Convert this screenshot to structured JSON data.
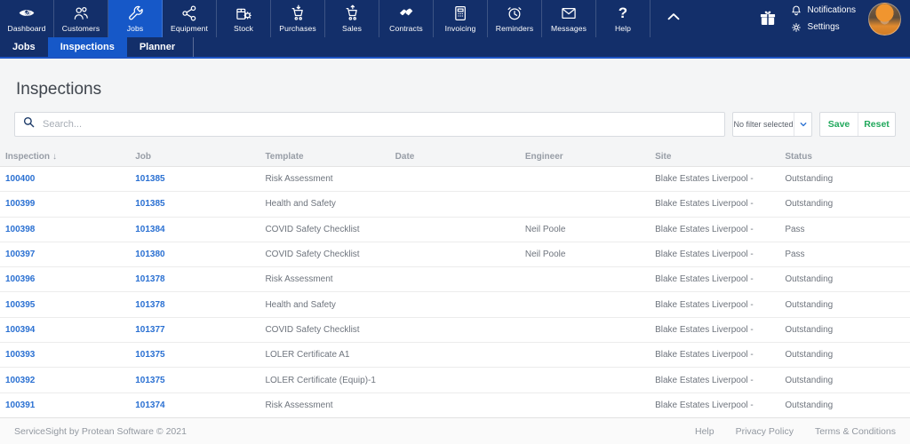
{
  "colors": {
    "navbar_bg": "#132f6a",
    "active_tab": "#1658c8",
    "link_blue": "#2a70d2",
    "action_green": "#21a85c"
  },
  "nav": {
    "items": [
      {
        "id": "dashboard",
        "label": "Dashboard",
        "icon": "eye-logo-icon",
        "active": false
      },
      {
        "id": "customers",
        "label": "Customers",
        "icon": "customers-icon",
        "active": false
      },
      {
        "id": "jobs",
        "label": "Jobs",
        "icon": "wrench-icon",
        "active": true
      },
      {
        "id": "equipment",
        "label": "Equipment",
        "icon": "equipment-network-icon",
        "active": false
      },
      {
        "id": "stock",
        "label": "Stock",
        "icon": "stock-box-icon",
        "active": false
      },
      {
        "id": "purchases",
        "label": "Purchases",
        "icon": "cart-down-icon",
        "active": false
      },
      {
        "id": "sales",
        "label": "Sales",
        "icon": "cart-up-icon",
        "active": false
      },
      {
        "id": "contracts",
        "label": "Contracts",
        "icon": "handshake-icon",
        "active": false
      },
      {
        "id": "invoicing",
        "label": "Invoicing",
        "icon": "invoice-icon",
        "active": false
      },
      {
        "id": "reminders",
        "label": "Reminders",
        "icon": "alarm-clock-icon",
        "active": false
      },
      {
        "id": "messages",
        "label": "Messages",
        "icon": "envelope-icon",
        "active": false
      },
      {
        "id": "help",
        "label": "Help",
        "icon": "question-icon",
        "active": false
      }
    ],
    "collapse_icon": "chevron-up-icon",
    "gift_icon": "gift-icon",
    "right": [
      {
        "id": "notifications",
        "label": "Notifications",
        "icon": "bell-icon"
      },
      {
        "id": "settings",
        "label": "Settings",
        "icon": "gear-icon"
      }
    ]
  },
  "subnav": {
    "items": [
      {
        "id": "jobs",
        "label": "Jobs",
        "active": false
      },
      {
        "id": "inspections",
        "label": "Inspections",
        "active": true
      },
      {
        "id": "planner",
        "label": "Planner",
        "active": false
      }
    ]
  },
  "page": {
    "title": "Inspections"
  },
  "toolbar": {
    "search_placeholder": "Search...",
    "filter_value": "No filter selected",
    "save_label": "Save",
    "reset_label": "Reset"
  },
  "table": {
    "columns": [
      {
        "label": "Inspection",
        "sort": "↓"
      },
      {
        "label": "Job"
      },
      {
        "label": "Template"
      },
      {
        "label": "Date"
      },
      {
        "label": "Engineer"
      },
      {
        "label": "Site"
      },
      {
        "label": "Status"
      }
    ],
    "rows": [
      {
        "inspection": "100400",
        "job": "101385",
        "template": "Risk Assessment",
        "date": "",
        "engineer": "",
        "site": "Blake Estates Liverpool -",
        "status": "Outstanding"
      },
      {
        "inspection": "100399",
        "job": "101385",
        "template": "Health and Safety",
        "date": "",
        "engineer": "",
        "site": "Blake Estates Liverpool -",
        "status": "Outstanding"
      },
      {
        "inspection": "100398",
        "job": "101384",
        "template": "COVID Safety Checklist",
        "date": "",
        "engineer": "Neil Poole",
        "site": "Blake Estates Liverpool -",
        "status": "Pass"
      },
      {
        "inspection": "100397",
        "job": "101380",
        "template": "COVID Safety Checklist",
        "date": "",
        "engineer": "Neil Poole",
        "site": "Blake Estates Liverpool -",
        "status": "Pass"
      },
      {
        "inspection": "100396",
        "job": "101378",
        "template": "Risk Assessment",
        "date": "",
        "engineer": "",
        "site": "Blake Estates Liverpool -",
        "status": "Outstanding"
      },
      {
        "inspection": "100395",
        "job": "101378",
        "template": "Health and Safety",
        "date": "",
        "engineer": "",
        "site": "Blake Estates Liverpool -",
        "status": "Outstanding"
      },
      {
        "inspection": "100394",
        "job": "101377",
        "template": "COVID Safety Checklist",
        "date": "",
        "engineer": "",
        "site": "Blake Estates Liverpool -",
        "status": "Outstanding"
      },
      {
        "inspection": "100393",
        "job": "101375",
        "template": "LOLER Certificate A1",
        "date": "",
        "engineer": "",
        "site": "Blake Estates Liverpool -",
        "status": "Outstanding"
      },
      {
        "inspection": "100392",
        "job": "101375",
        "template": "LOLER Certificate (Equip)-1",
        "date": "",
        "engineer": "",
        "site": "Blake Estates Liverpool -",
        "status": "Outstanding"
      },
      {
        "inspection": "100391",
        "job": "101374",
        "template": "Risk Assessment",
        "date": "",
        "engineer": "",
        "site": "Blake Estates Liverpool -",
        "status": "Outstanding"
      }
    ]
  },
  "footer": {
    "copyright": "ServiceSight by Protean Software © 2021",
    "links": [
      {
        "id": "help",
        "label": "Help"
      },
      {
        "id": "privacy",
        "label": "Privacy Policy"
      },
      {
        "id": "terms",
        "label": "Terms & Conditions"
      }
    ]
  }
}
